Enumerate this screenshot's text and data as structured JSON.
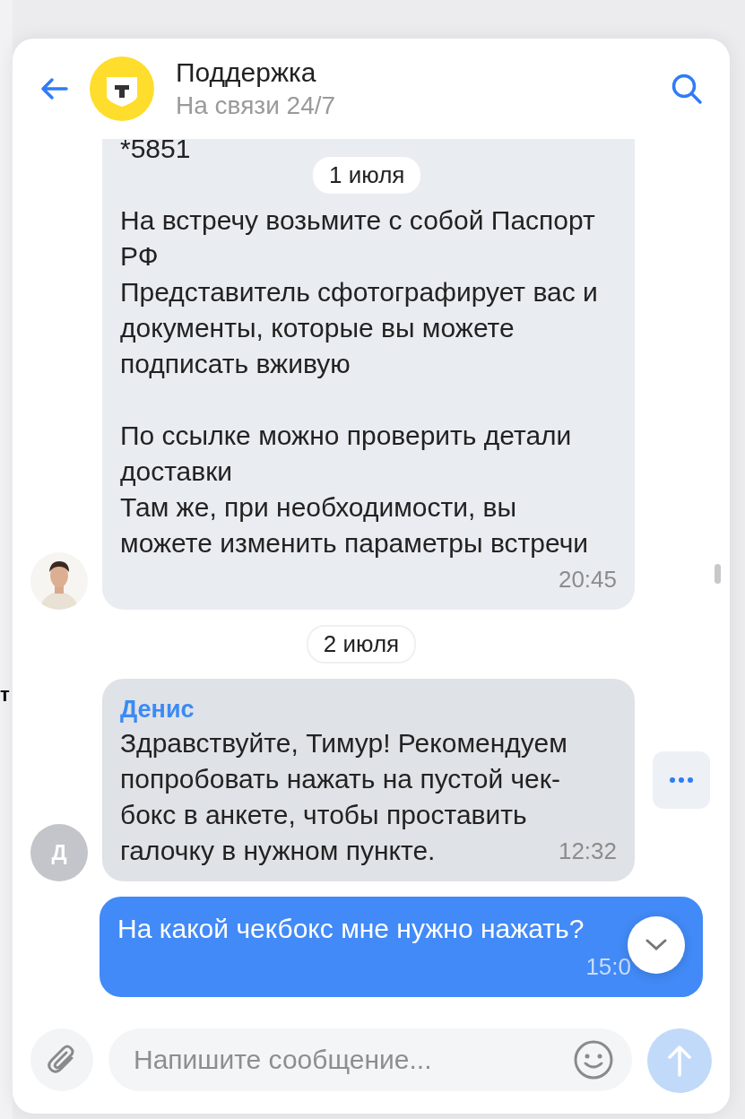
{
  "background_fragment": "т",
  "header": {
    "title": "Поддержка",
    "subtitle": "На связи 24/7"
  },
  "sticky_date": "1 июля",
  "messages": [
    {
      "kind": "incoming",
      "avatar": {
        "kind": "picture"
      },
      "paragraphs": [
        [
          "*5851"
        ],
        [
          "На встречу возьмите с собой Паспорт",
          "РФ",
          "Представитель сфотографирует вас и",
          "документы, которые вы можете",
          "подписать вживую"
        ],
        [
          "По ссылке можно проверить детали",
          "доставки",
          "Там же, при необходимости, вы",
          "можете изменить параметры встречи"
        ]
      ],
      "time": "20:45"
    },
    {
      "kind": "date",
      "text": "2 июля"
    },
    {
      "kind": "incoming",
      "avatar": {
        "kind": "letter",
        "text": "Д"
      },
      "author": "Денис",
      "paragraphs": [
        [
          "Здравствуйте, Тимур! Рекомендуем",
          "попробовать нажать на пустой чек-",
          "бокс в анкете, чтобы проставить",
          "галочку в нужном пункте."
        ]
      ],
      "time": "12:32",
      "more_button": true
    },
    {
      "kind": "outgoing",
      "paragraphs": [
        [
          "На какой чекбокс мне нужно нажать?"
        ]
      ],
      "time": "15:0"
    }
  ],
  "composer": {
    "placeholder": "Напишите сообщение...",
    "send_disabled": true
  }
}
